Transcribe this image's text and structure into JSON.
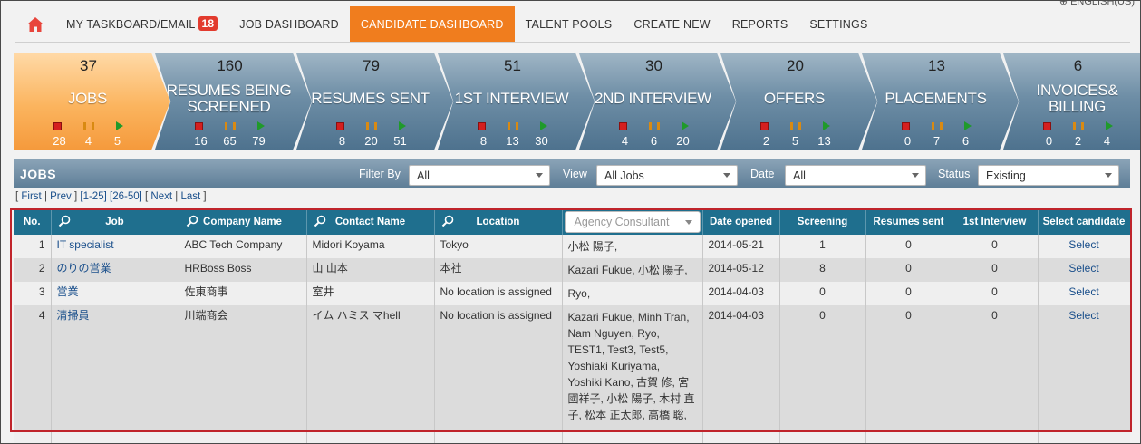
{
  "lang": "ENGLISH(US)",
  "nav": {
    "items": [
      {
        "label": "MY TASKBOARD/EMAIL",
        "badge": "18"
      },
      {
        "label": "JOB DASHBOARD"
      },
      {
        "label": "CANDIDATE DASHBOARD",
        "active": true
      },
      {
        "label": "TALENT POOLS"
      },
      {
        "label": "CREATE NEW"
      },
      {
        "label": "REPORTS"
      },
      {
        "label": "SETTINGS"
      }
    ]
  },
  "pipeline": [
    {
      "count": "37",
      "label": "JOBS",
      "nums": [
        "28",
        "4",
        "5"
      ]
    },
    {
      "count": "160",
      "label": "RESUMES BEING SCREENED",
      "nums": [
        "16",
        "65",
        "79"
      ]
    },
    {
      "count": "79",
      "label": "RESUMES SENT",
      "nums": [
        "8",
        "20",
        "51"
      ]
    },
    {
      "count": "51",
      "label": "1ST INTERVIEW",
      "nums": [
        "8",
        "13",
        "30"
      ]
    },
    {
      "count": "30",
      "label": "2ND INTERVIEW",
      "nums": [
        "4",
        "6",
        "20"
      ]
    },
    {
      "count": "20",
      "label": "OFFERS",
      "nums": [
        "2",
        "5",
        "13"
      ]
    },
    {
      "count": "13",
      "label": "PLACEMENTS",
      "nums": [
        "0",
        "7",
        "6"
      ]
    },
    {
      "count": "6",
      "label": "INVOICES& BILLING",
      "nums": [
        "0",
        "2",
        "4"
      ]
    }
  ],
  "jobs": {
    "title": "JOBS",
    "filter_by_label": "Filter By",
    "filter_by_value": "All",
    "view_label": "View",
    "view_value": "All Jobs",
    "date_label": "Date",
    "date_value": "All",
    "status_label": "Status",
    "status_value": "Existing"
  },
  "pager": {
    "first": "First",
    "prev": "Prev",
    "current": "[1-25]",
    "next_range": "[26-50]",
    "next": "Next",
    "last": "Last"
  },
  "table": {
    "headers": {
      "no": "No.",
      "job": "Job",
      "company": "Company Name",
      "contact": "Contact Name",
      "location": "Location",
      "agency": "Agency Consultant",
      "date": "Date opened",
      "screening": "Screening",
      "resumes": "Resumes sent",
      "interview": "1st Interview",
      "select": "Select candidate"
    },
    "rows": [
      {
        "no": "1",
        "job": "IT specialist",
        "company": "ABC Tech Company",
        "contact": "Midori Koyama",
        "location": "Tokyo",
        "agency": "小松 陽子,",
        "date": "2014-05-21",
        "screening": "1",
        "resumes": "0",
        "interview": "0",
        "select": "Select"
      },
      {
        "no": "2",
        "job": "のりの営業",
        "company": "HRBoss Boss",
        "contact": "山 山本",
        "location": "本社",
        "agency": "Kazari Fukue, 小松 陽子,",
        "date": "2014-05-12",
        "screening": "8",
        "resumes": "0",
        "interview": "0",
        "select": "Select"
      },
      {
        "no": "3",
        "job": "営業",
        "company": "佐東商事",
        "contact": "室井",
        "location": "No location is assigned",
        "agency": "Ryo,",
        "date": "2014-04-03",
        "screening": "0",
        "resumes": "0",
        "interview": "0",
        "select": "Select"
      },
      {
        "no": "4",
        "job": "清掃員",
        "company": "川端商会",
        "contact": "イム ハミス マhell",
        "location": "No location is assigned",
        "agency": "Kazari Fukue, Minh Tran, Nam Nguyen, Ryo, TEST1, Test3, Test5, Yoshiaki Kuriyama, Yoshiki Kano, 古賀 修, 宮國祥子, 小松 陽子, 木村 直子, 松本 正太郎, 高橋 聡,",
        "date": "2014-04-03",
        "screening": "0",
        "resumes": "0",
        "interview": "0",
        "select": "Select"
      }
    ]
  },
  "colors": {
    "accent": "#f07d1e",
    "header": "#1f6f8e",
    "badge": "#e23b2e",
    "highlight": "#c0242b"
  }
}
